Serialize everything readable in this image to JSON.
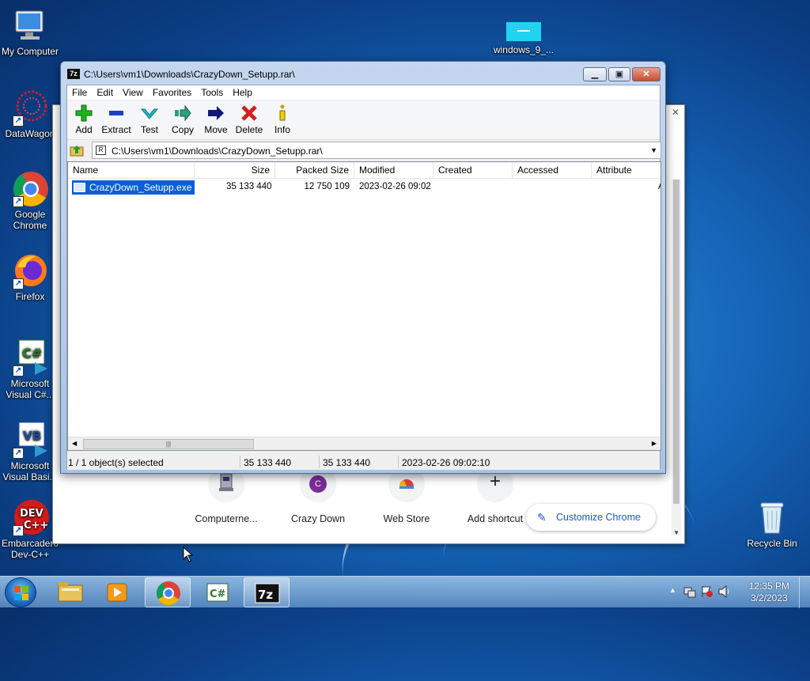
{
  "desktop": {
    "icons": [
      {
        "label": "My Computer"
      },
      {
        "label": "DataWagon"
      },
      {
        "label": "Google Chrome"
      },
      {
        "label": "Firefox"
      },
      {
        "label": "Microsoft Visual C#..."
      },
      {
        "label": "Microsoft Visual Basi..."
      },
      {
        "label": "Embarcadero Dev-C++"
      },
      {
        "label": "windows_9_..."
      },
      {
        "label": "Recycle Bin"
      }
    ]
  },
  "chrome": {
    "tiles": [
      {
        "label": "Computerne...",
        "badge": ""
      },
      {
        "label": "Crazy Down",
        "badge": "C"
      },
      {
        "label": "Web Store",
        "badge": ""
      },
      {
        "label": "Add shortcut",
        "badge": "+"
      }
    ],
    "customize_label": "Customize Chrome"
  },
  "zip": {
    "app_icon": "7z",
    "title": "C:\\Users\\vm1\\Downloads\\CrazyDown_Setupp.rar\\",
    "menu": [
      "File",
      "Edit",
      "View",
      "Favorites",
      "Tools",
      "Help"
    ],
    "toolbar": [
      {
        "label": "Add",
        "icon": "plus-icon",
        "color": "#1db31d"
      },
      {
        "label": "Extract",
        "icon": "minus-icon",
        "color": "#1e3fc8"
      },
      {
        "label": "Test",
        "icon": "check-icon",
        "color": "#22b8c8"
      },
      {
        "label": "Copy",
        "icon": "copy-arrow-icon",
        "color": "#2aa17a"
      },
      {
        "label": "Move",
        "icon": "move-arrow-icon",
        "color": "#101a7a"
      },
      {
        "label": "Delete",
        "icon": "x-icon",
        "color": "#d42020"
      },
      {
        "label": "Info",
        "icon": "info-icon",
        "color": "#c8a400"
      }
    ],
    "address": "C:\\Users\\vm1\\Downloads\\CrazyDown_Setupp.rar\\",
    "columns": [
      "Name",
      "Size",
      "Packed Size",
      "Modified",
      "Created",
      "Accessed",
      "Attribute"
    ],
    "rows": [
      {
        "name": "CrazyDown_Setupp.exe",
        "size": "35 133 440",
        "packed": "12 750 109",
        "modified": "2023-02-26 09:02",
        "created": "",
        "accessed": "",
        "attr": "A"
      }
    ],
    "status": {
      "selected": "1 / 1 object(s) selected",
      "size": "35 133 440",
      "packed": "35 133 440",
      "modified": "2023-02-26 09:02:10"
    }
  },
  "taskbar": {
    "time": "12:35 PM",
    "date": "3/2/2023"
  }
}
